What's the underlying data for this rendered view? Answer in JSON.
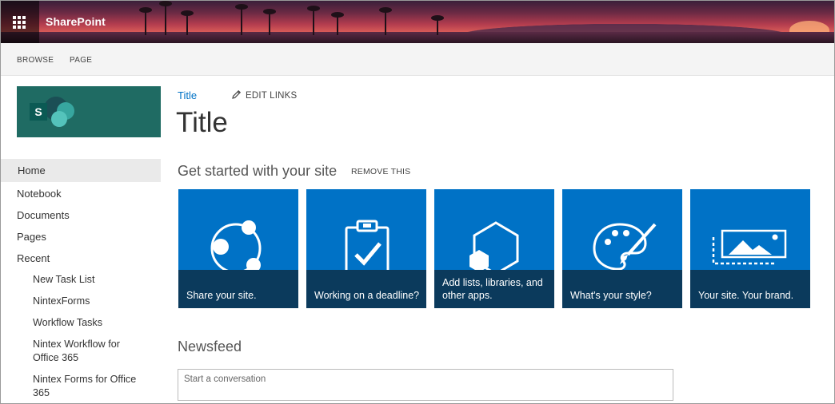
{
  "suite_bar": {
    "app_name": "SharePoint",
    "waffle_icon": "app-launcher-icon"
  },
  "ribbon": {
    "tabs": [
      "BROWSE",
      "PAGE"
    ]
  },
  "left_nav": {
    "logo_icon": "sharepoint-logo-icon",
    "logo_letter": "S",
    "home": "Home",
    "items": [
      "Notebook",
      "Documents",
      "Pages",
      "Recent"
    ],
    "recent_items": [
      "New Task List",
      "NintexForms",
      "Workflow Tasks",
      "Nintex Workflow for\nOffice 365",
      "Nintex Forms for Office\n365"
    ]
  },
  "main": {
    "breadcrumb_title": "Title",
    "edit_links": "EDIT LINKS",
    "edit_icon": "pencil-icon",
    "page_title": "Title",
    "get_started": {
      "heading": "Get started with your site",
      "remove": "REMOVE THIS",
      "tiles": [
        {
          "label": "Share your site.",
          "icon": "share-icon"
        },
        {
          "label": "Working on a deadline?",
          "icon": "clipboard-check-icon"
        },
        {
          "label": "Add lists, libraries, and other apps.",
          "icon": "add-apps-icon"
        },
        {
          "label": "What's your style?",
          "icon": "palette-icon"
        },
        {
          "label": "Your site. Your brand.",
          "icon": "site-brand-icon"
        }
      ]
    },
    "newsfeed": {
      "heading": "Newsfeed",
      "placeholder": "Start a conversation"
    }
  },
  "colors": {
    "tile_blue": "#0072c6",
    "tile_band": "#0b3a5c",
    "link_blue": "#0072c6",
    "logo_green": "#1f6b63"
  }
}
